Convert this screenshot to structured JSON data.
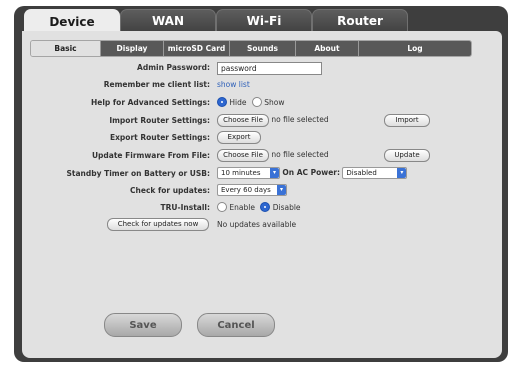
{
  "tabs": [
    "Device",
    "WAN",
    "Wi-Fi",
    "Router"
  ],
  "subtabs": [
    "Basic",
    "Display",
    "microSD Card",
    "Sounds",
    "About",
    "Log"
  ],
  "form": {
    "admin_password_label": "Admin Password:",
    "admin_password_value": "password",
    "remember_label": "Remember me client list:",
    "remember_link": "show list",
    "help_label": "Help for Advanced Settings:",
    "help_hide": "Hide",
    "help_show": "Show",
    "import_label": "Import Router Settings:",
    "choose_file": "Choose File",
    "no_file": "no file selected",
    "import_button": "Import",
    "export_label": "Export Router Settings:",
    "export_button": "Export",
    "firmware_label": "Update Firmware From File:",
    "update_button": "Update",
    "standby_label": "Standby Timer on Battery or USB:",
    "standby_value": "10 minutes",
    "ac_power_label": "On AC Power:",
    "ac_power_value": "Disabled",
    "check_updates_label": "Check for updates:",
    "check_updates_value": "Every 60 days",
    "tru_install_label": "TRU-Install:",
    "tru_enable": "Enable",
    "tru_disable": "Disable",
    "check_now_button": "Check for updates now",
    "check_now_status": "No updates available"
  },
  "footer": {
    "save": "Save",
    "cancel": "Cancel"
  },
  "colors": {
    "accent": "#2e67d0",
    "frame": "#3e3e3e",
    "panel": "#e1e1e1"
  }
}
